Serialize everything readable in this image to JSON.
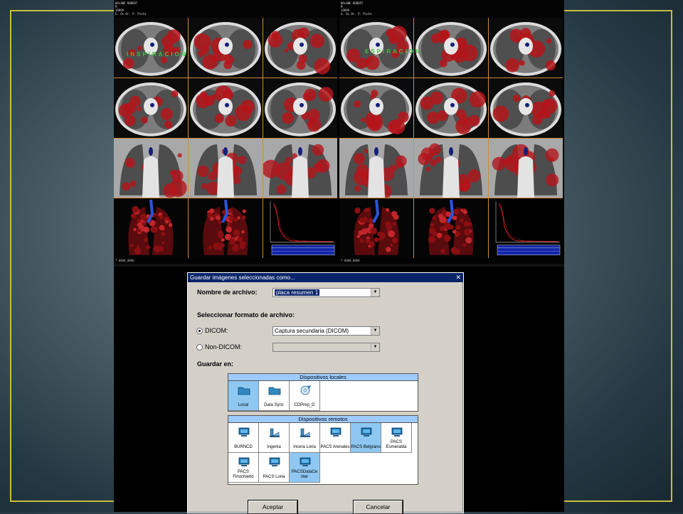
{
  "left_panel": {
    "header": [
      "BALANE ROBERT",
      "M",
      "19899",
      "G. Os Dr. P. Pinto"
    ],
    "sequence_label": "INSPIRACION",
    "footer": "T 0000_0000"
  },
  "right_panel": {
    "header": [
      "BALANE ROBERT",
      "M",
      "19899",
      "G. Os Dr. P. Pinto"
    ],
    "sequence_label": "ESPIRACION",
    "footer": "T 0000_0000"
  },
  "dialog": {
    "title": "Guardar imágenes seleccionadas como...",
    "close_glyph": "✕",
    "filename_label": "Nombre de archivo:",
    "filename_value": "placa resumen 1",
    "format_label": "Seleccionar formato de archivo:",
    "dicom_label": "DICOM:",
    "dicom_value": "Captura secundaria (DICOM)",
    "nondicom_label": "Non-DICOM:",
    "save_in_label": "Guardar en:",
    "local_group": "Dispositivos locales",
    "local_devices": [
      {
        "label": "Local",
        "icon": "folder-icon",
        "selected": true
      },
      {
        "label": "Data Sync",
        "icon": "folder-icon",
        "selected": false
      },
      {
        "label": "CDPrep_D",
        "icon": "cd-icon",
        "selected": false
      }
    ],
    "remote_group": "Dispositivos remotos",
    "remote_devices": [
      {
        "label": "BURNCD",
        "icon": "monitor-icon",
        "selected": false
      },
      {
        "label": "Ingenia",
        "icon": "scanner-icon",
        "selected": false
      },
      {
        "label": "Incera Loria",
        "icon": "scanner-icon",
        "selected": false
      },
      {
        "label": "PACS Arenales",
        "icon": "monitor-icon",
        "selected": false
      },
      {
        "label": "PACS Belgrano",
        "icon": "monitor-icon",
        "selected": true
      },
      {
        "label": "PACS Esmeralda",
        "icon": "monitor-icon",
        "selected": false
      },
      {
        "label": "PACS Finochietto",
        "icon": "monitor-icon",
        "selected": false
      },
      {
        "label": "PACS Loria",
        "icon": "monitor-icon",
        "selected": false
      },
      {
        "label": "PACSDataCe nter",
        "icon": "monitor-icon",
        "selected": true
      }
    ],
    "accept_label": "Aceptar",
    "cancel_label": "Cancelar"
  }
}
